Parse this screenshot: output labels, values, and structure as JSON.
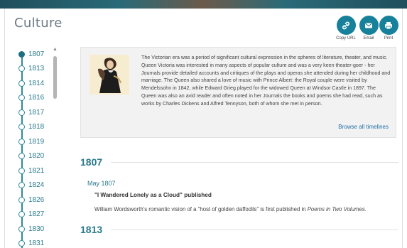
{
  "page": {
    "title": "Culture"
  },
  "share": {
    "copy_url": "Copy URL",
    "email": "Email",
    "print": "Print",
    "accent_color": "#17809a"
  },
  "timeline": {
    "years": [
      "1807",
      "1813",
      "1814",
      "1816",
      "1817",
      "1818",
      "1819",
      "1820",
      "1821",
      "1824",
      "1826",
      "1827",
      "1830",
      "1831"
    ],
    "active": "1807"
  },
  "intro": {
    "text": "The Victorian era was a period of significant cultural expression in the spheres of literature, theater, and music. Queen Victoria was interested in many aspects of popular culture and was a very keen theater-goer - her Journals provide detailed accounts and critiques of the plays and operas she attended during her childhood and marriage. The Queen also shared a love of music with Prince Albert: the Royal couple were visited by Mendelssohn in 1842, while Edward Grieg played for the widowed Queen at Windsor Castle in 1897. The Queen was also an avid reader and often noted in her Journals the books and poems she had read, such as works by Charles Dickens and Alfred Tennyson, both of whom she met in person.",
    "browse_link": "Browse all timelines"
  },
  "sections": [
    {
      "year": "1807",
      "month": "May 1807",
      "event_title": "\"I Wandered Lonely as a Cloud\" published",
      "event_desc_prefix": "William Wordsworth's romantic vision of a \"host of golden daffodils\" is first published in ",
      "event_desc_italic": "Poems in Two Volumes",
      "event_desc_suffix": "."
    },
    {
      "year": "1813"
    }
  ]
}
